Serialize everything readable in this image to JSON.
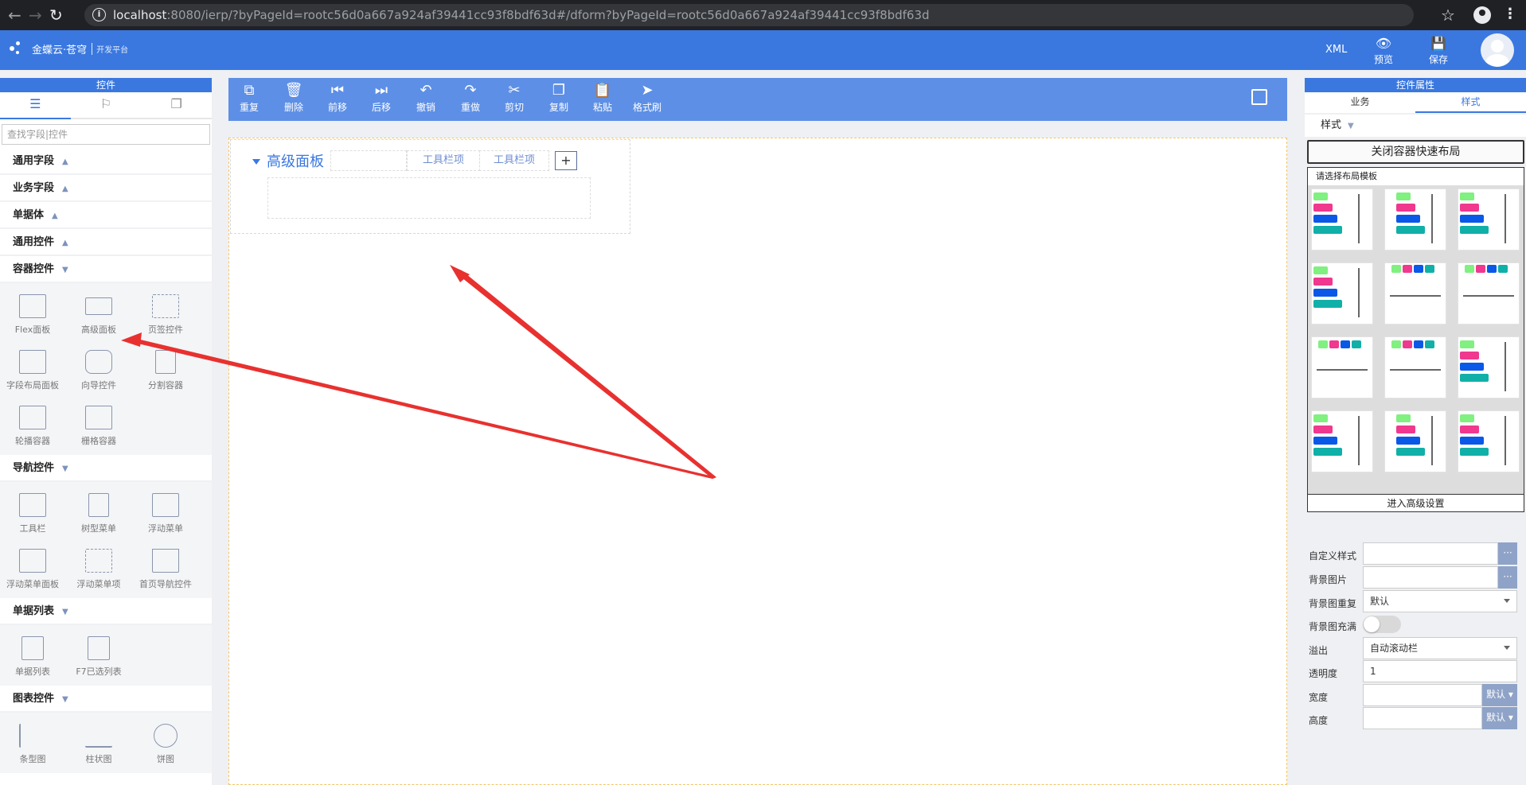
{
  "browser": {
    "url_host": "localhost",
    "url_rest": ":8080/ierp/?byPageId=rootc56d0a667a924af39441cc93f8bdf63d#/dform?byPageId=rootc56d0a667a924af39441cc93f8bdf63d"
  },
  "header": {
    "logo_text": "金蝶云·苍穹",
    "logo_sub": "开发平台",
    "xml_label": "XML",
    "preview_label": "预览",
    "save_label": "保存"
  },
  "left_panel": {
    "title": "控件",
    "search_placeholder": "查找字段|控件",
    "sections": [
      {
        "label": "通用字段",
        "expanded": false
      },
      {
        "label": "业务字段",
        "expanded": false
      },
      {
        "label": "单据体",
        "expanded": false
      },
      {
        "label": "通用控件",
        "expanded": false
      },
      {
        "label": "容器控件",
        "expanded": true,
        "items": [
          "Flex面板",
          "高级面板",
          "页签控件",
          "字段布局面板",
          "向导控件",
          "分割容器",
          "轮播容器",
          "栅格容器"
        ]
      },
      {
        "label": "导航控件",
        "expanded": true,
        "items": [
          "工具栏",
          "树型菜单",
          "浮动菜单",
          "浮动菜单面板",
          "浮动菜单项",
          "首页导航控件"
        ]
      },
      {
        "label": "单据列表",
        "expanded": true,
        "items": [
          "单据列表",
          "F7已选列表"
        ]
      },
      {
        "label": "图表控件",
        "expanded": true,
        "items": [
          "条型图",
          "柱状图",
          "饼图"
        ]
      }
    ]
  },
  "toolbar": {
    "buttons": [
      "重复",
      "删除",
      "前移",
      "后移",
      "撤销",
      "重做",
      "剪切",
      "复制",
      "粘贴",
      "格式刷"
    ]
  },
  "canvas": {
    "panel_title": "高级面板",
    "toolbar_items": [
      "工具栏项",
      "工具栏项"
    ],
    "add_label": "+"
  },
  "right_panel": {
    "title": "控件属性",
    "tabs": [
      "业务",
      "样式"
    ],
    "active_tab": "样式",
    "style_label": "样式",
    "quick_layout_button": "关闭容器快速布局",
    "template_header": "请选择布局模板",
    "advanced_settings": "进入高级设置",
    "props": {
      "custom_style": "自定义样式",
      "bg_image": "背景图片",
      "bg_repeat": "背景图重复",
      "bg_repeat_value": "默认",
      "bg_fill": "背景图充满",
      "overflow": "溢出",
      "overflow_value": "自动滚动栏",
      "opacity": "透明度",
      "opacity_value": "1",
      "width": "宽度",
      "height": "高度",
      "default_btn": "默认",
      "ellipsis": "···"
    }
  },
  "colors": {
    "brand_blue": "#3a78e0",
    "toolbar_blue": "#5d8fe6",
    "annotation_red": "#e8312f"
  }
}
